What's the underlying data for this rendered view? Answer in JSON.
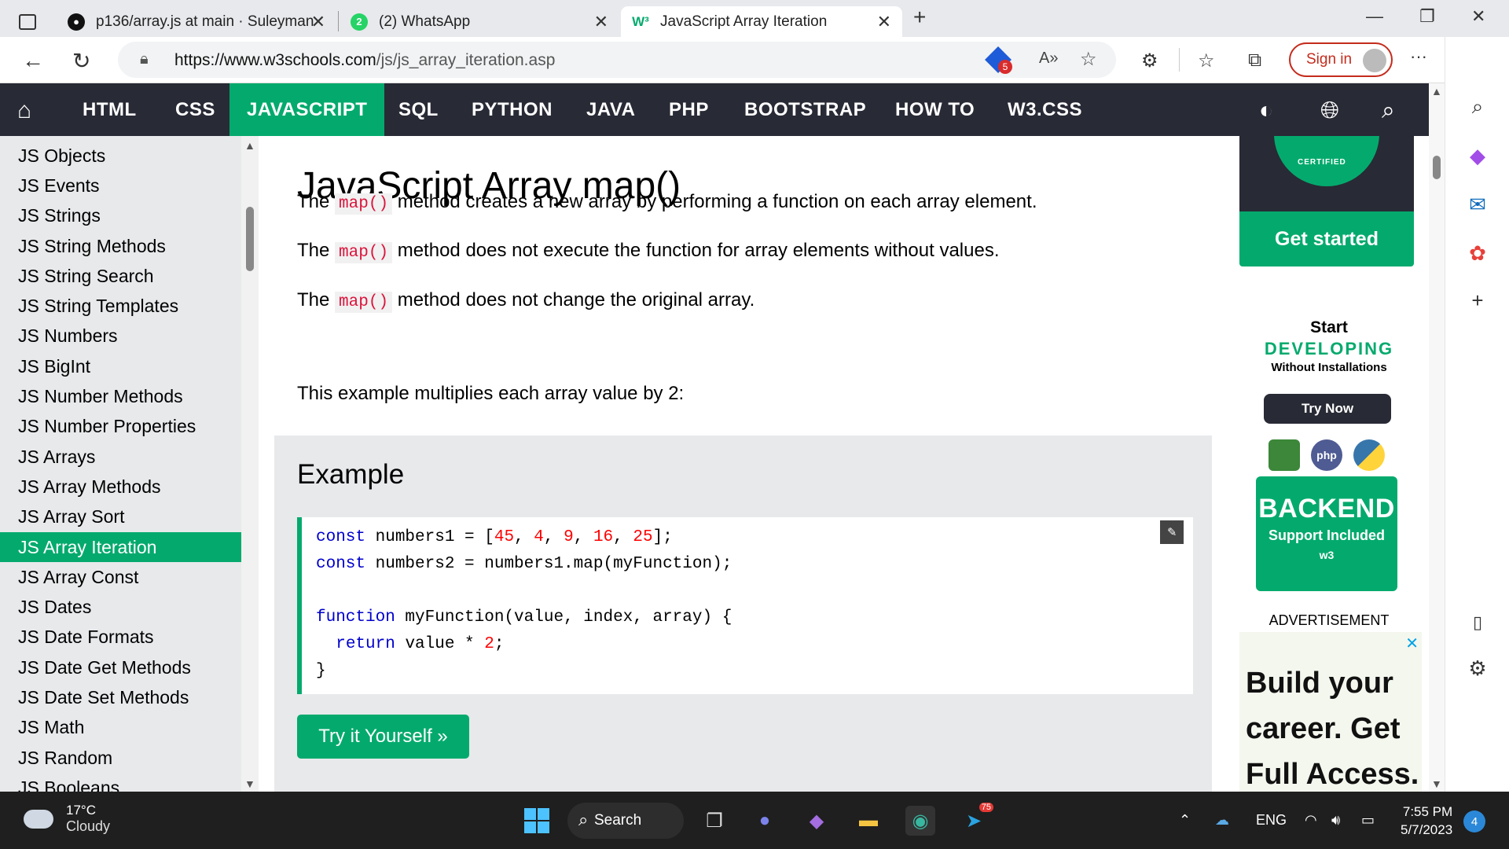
{
  "browser": {
    "tabs": [
      {
        "title": "p136/array.js at main · Suleyman",
        "active": false
      },
      {
        "title": "(2) WhatsApp",
        "badge": "2",
        "active": false
      },
      {
        "title": "JavaScript Array Iteration",
        "active": true
      }
    ],
    "new_tab": "+",
    "url_host": "https://www.w3schools.com",
    "url_path": "/js/js_array_iteration.asp",
    "extension_badge": "5",
    "sign_in": "Sign in",
    "more": "···"
  },
  "w3nav": {
    "items": [
      "HTML",
      "CSS",
      "JAVASCRIPT",
      "SQL",
      "PYTHON",
      "JAVA",
      "PHP",
      "BOOTSTRAP",
      "HOW TO",
      "W3.CSS"
    ],
    "active": "JAVASCRIPT"
  },
  "sidebar": {
    "items": [
      "JS Objects",
      "JS Events",
      "JS Strings",
      "JS String Methods",
      "JS String Search",
      "JS String Templates",
      "JS Numbers",
      "JS BigInt",
      "JS Number Methods",
      "JS Number Properties",
      "JS Arrays",
      "JS Array Methods",
      "JS Array Sort",
      "JS Array Iteration",
      "JS Array Const",
      "JS Dates",
      "JS Date Formats",
      "JS Date Get Methods",
      "JS Date Set Methods",
      "JS Math",
      "JS Random",
      "JS Booleans"
    ],
    "active_index": 13
  },
  "main": {
    "title": "JavaScript Array map()",
    "code_term": "map()",
    "p1_pre": "The",
    "p1_post": "method creates a new array by performing a function on each array element.",
    "p2_pre": "The",
    "p2_post": "method does not execute the function for array elements without values.",
    "p3_pre": "The",
    "p3_post": "method does not change the original array.",
    "p4": "This example multiplies each array value by 2:",
    "example_heading": "Example",
    "try_button": "Try it Yourself »"
  },
  "ads": {
    "get_started": "Get started",
    "certified": "CERTIFIED",
    "start_line1": "Start",
    "start_line2": "DEVELOPING",
    "start_line3": "Without Installations",
    "try_now": "Try Now",
    "php_icon": "php",
    "backend": "BACKEND",
    "backend_sub": "Support Included",
    "backend_logo": "w3",
    "advertisement": "ADVERTISEMENT",
    "close": "✕",
    "career": "Build your career. Get Full Access."
  },
  "taskbar": {
    "temp": "17°C",
    "condition": "Cloudy",
    "search": "Search",
    "lang": "ENG",
    "time": "7:55 PM",
    "date": "5/7/2023",
    "telegram_badge": "75",
    "notifications": "4"
  },
  "colors": {
    "w3_green": "#04aa6d",
    "w3_dark": "#282a35",
    "code_red": "#dc143c",
    "keyword_blue": "#0000cd"
  }
}
